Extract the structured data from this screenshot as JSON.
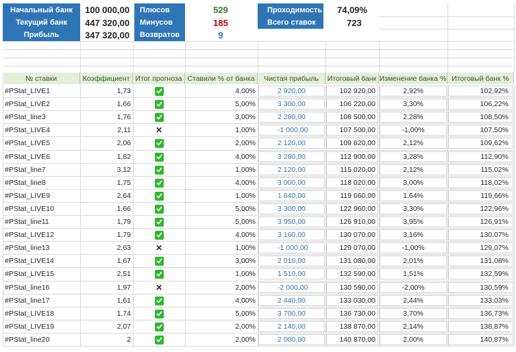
{
  "summary": {
    "start_bank_label": "Начальный банк",
    "start_bank_value": "100 000,00",
    "current_bank_label": "Текущий банк",
    "current_bank_value": "447 320,00",
    "profit_label": "Прибыль",
    "profit_value": "347 320,00",
    "plus_label": "Плюсов",
    "plus_value": "529",
    "minus_label": "Минусов",
    "minus_value": "185",
    "returns_label": "Возвратов",
    "returns_value": "9",
    "pass_label": "Проходимость",
    "pass_value": "74,09%",
    "total_label": "Всего ставок",
    "total_value": "723",
    "colors": {
      "plus": "#3a7d22",
      "minus": "#c00000",
      "returns": "#2e75b6",
      "header_bg": "#2e75b6"
    }
  },
  "table": {
    "headers": [
      "№ ставки",
      "Коэффициент",
      "Итог прогноза",
      "Ставили % от банка",
      "Чистая прибыль",
      "Итоговый банк",
      "Изменение банка %",
      "Итоговый банк %"
    ],
    "rows": [
      {
        "id": "#PStat_LIVE1",
        "coef": "1,73",
        "result": "win",
        "stake": "4,00%",
        "profit": "2 920,00",
        "bank": "102 920,00",
        "change": "2,92%",
        "bank_pct": "102,92%"
      },
      {
        "id": "#PStat_LIVE2",
        "coef": "1,66",
        "result": "win",
        "stake": "5,00%",
        "profit": "3 300,00",
        "bank": "106 220,00",
        "change": "3,30%",
        "bank_pct": "106,22%"
      },
      {
        "id": "#PStat_line3",
        "coef": "1,76",
        "result": "win",
        "stake": "3,00%",
        "profit": "2 280,00",
        "bank": "108 500,00",
        "change": "2,28%",
        "bank_pct": "108,50%"
      },
      {
        "id": "#PStat_LIVE4",
        "coef": "2,11",
        "result": "loss",
        "stake": "1,00%",
        "profit": "-1 000,00",
        "bank": "107 500,00",
        "change": "-1,00%",
        "bank_pct": "107,50%"
      },
      {
        "id": "#PStat_LIVE5",
        "coef": "2,06",
        "result": "win",
        "stake": "2,00%",
        "profit": "2 120,00",
        "bank": "109 620,00",
        "change": "2,12%",
        "bank_pct": "109,62%"
      },
      {
        "id": "#PStat_LIVE6",
        "coef": "1,82",
        "result": "win",
        "stake": "4,00%",
        "profit": "3 280,00",
        "bank": "112 900,00",
        "change": "3,28%",
        "bank_pct": "112,90%"
      },
      {
        "id": "#PStat_line7",
        "coef": "3,12",
        "result": "win",
        "stake": "1,00%",
        "profit": "2 120,00",
        "bank": "115 020,00",
        "change": "2,12%",
        "bank_pct": "115,02%"
      },
      {
        "id": "#PStat_line8",
        "coef": "1,75",
        "result": "win",
        "stake": "4,00%",
        "profit": "3 000,00",
        "bank": "118 020,00",
        "change": "3,00%",
        "bank_pct": "118,02%"
      },
      {
        "id": "#PStat_LIVE9",
        "coef": "2,64",
        "result": "win",
        "stake": "1,00%",
        "profit": "1 640,00",
        "bank": "119 660,00",
        "change": "1,64%",
        "bank_pct": "119,66%"
      },
      {
        "id": "#PStat_LIVE10",
        "coef": "1,66",
        "result": "win",
        "stake": "5,00%",
        "profit": "3 300,00",
        "bank": "122 960,00",
        "change": "3,30%",
        "bank_pct": "122,96%"
      },
      {
        "id": "#PStat_line11",
        "coef": "1,79",
        "result": "win",
        "stake": "5,00%",
        "profit": "3 950,00",
        "bank": "126 910,00",
        "change": "3,95%",
        "bank_pct": "126,91%"
      },
      {
        "id": "#PStat_LIVE12",
        "coef": "1,79",
        "result": "win",
        "stake": "4,00%",
        "profit": "3 160,00",
        "bank": "130 070,00",
        "change": "3,16%",
        "bank_pct": "130,07%"
      },
      {
        "id": "#PStat_line13",
        "coef": "2,63",
        "result": "loss",
        "stake": "1,00%",
        "profit": "-1 000,00",
        "bank": "129 070,00",
        "change": "-1,00%",
        "bank_pct": "129,07%"
      },
      {
        "id": "#PStat_LIVE14",
        "coef": "1,67",
        "result": "win",
        "stake": "3,00%",
        "profit": "2 010,00",
        "bank": "131 080,00",
        "change": "2,01%",
        "bank_pct": "131,08%"
      },
      {
        "id": "#PStat_LIVE15",
        "coef": "2,51",
        "result": "win",
        "stake": "1,00%",
        "profit": "1 510,00",
        "bank": "132 590,00",
        "change": "1,51%",
        "bank_pct": "132,59%"
      },
      {
        "id": "#PStat_line16",
        "coef": "1,97",
        "result": "loss",
        "stake": "2,00%",
        "profit": "-2 000,00",
        "bank": "130 590,00",
        "change": "-2,00%",
        "bank_pct": "130,59%"
      },
      {
        "id": "#PStat_line17",
        "coef": "1,61",
        "result": "win",
        "stake": "4,00%",
        "profit": "2 440,00",
        "bank": "133 030,00",
        "change": "2,44%",
        "bank_pct": "133,03%"
      },
      {
        "id": "#PStat_LIVE18",
        "coef": "1,74",
        "result": "win",
        "stake": "5,00%",
        "profit": "3 700,00",
        "bank": "136 730,00",
        "change": "3,70%",
        "bank_pct": "136,73%"
      },
      {
        "id": "#PStat_LIVE19",
        "coef": "2,07",
        "result": "win",
        "stake": "2,00%",
        "profit": "2 140,00",
        "bank": "138 870,00",
        "change": "2,14%",
        "bank_pct": "138,87%"
      },
      {
        "id": "#PStat_line20",
        "coef": "2",
        "result": "win",
        "stake": "2,00%",
        "profit": "2 000,00",
        "bank": "140 870,00",
        "change": "2,00%",
        "bank_pct": "140,87%"
      }
    ]
  }
}
